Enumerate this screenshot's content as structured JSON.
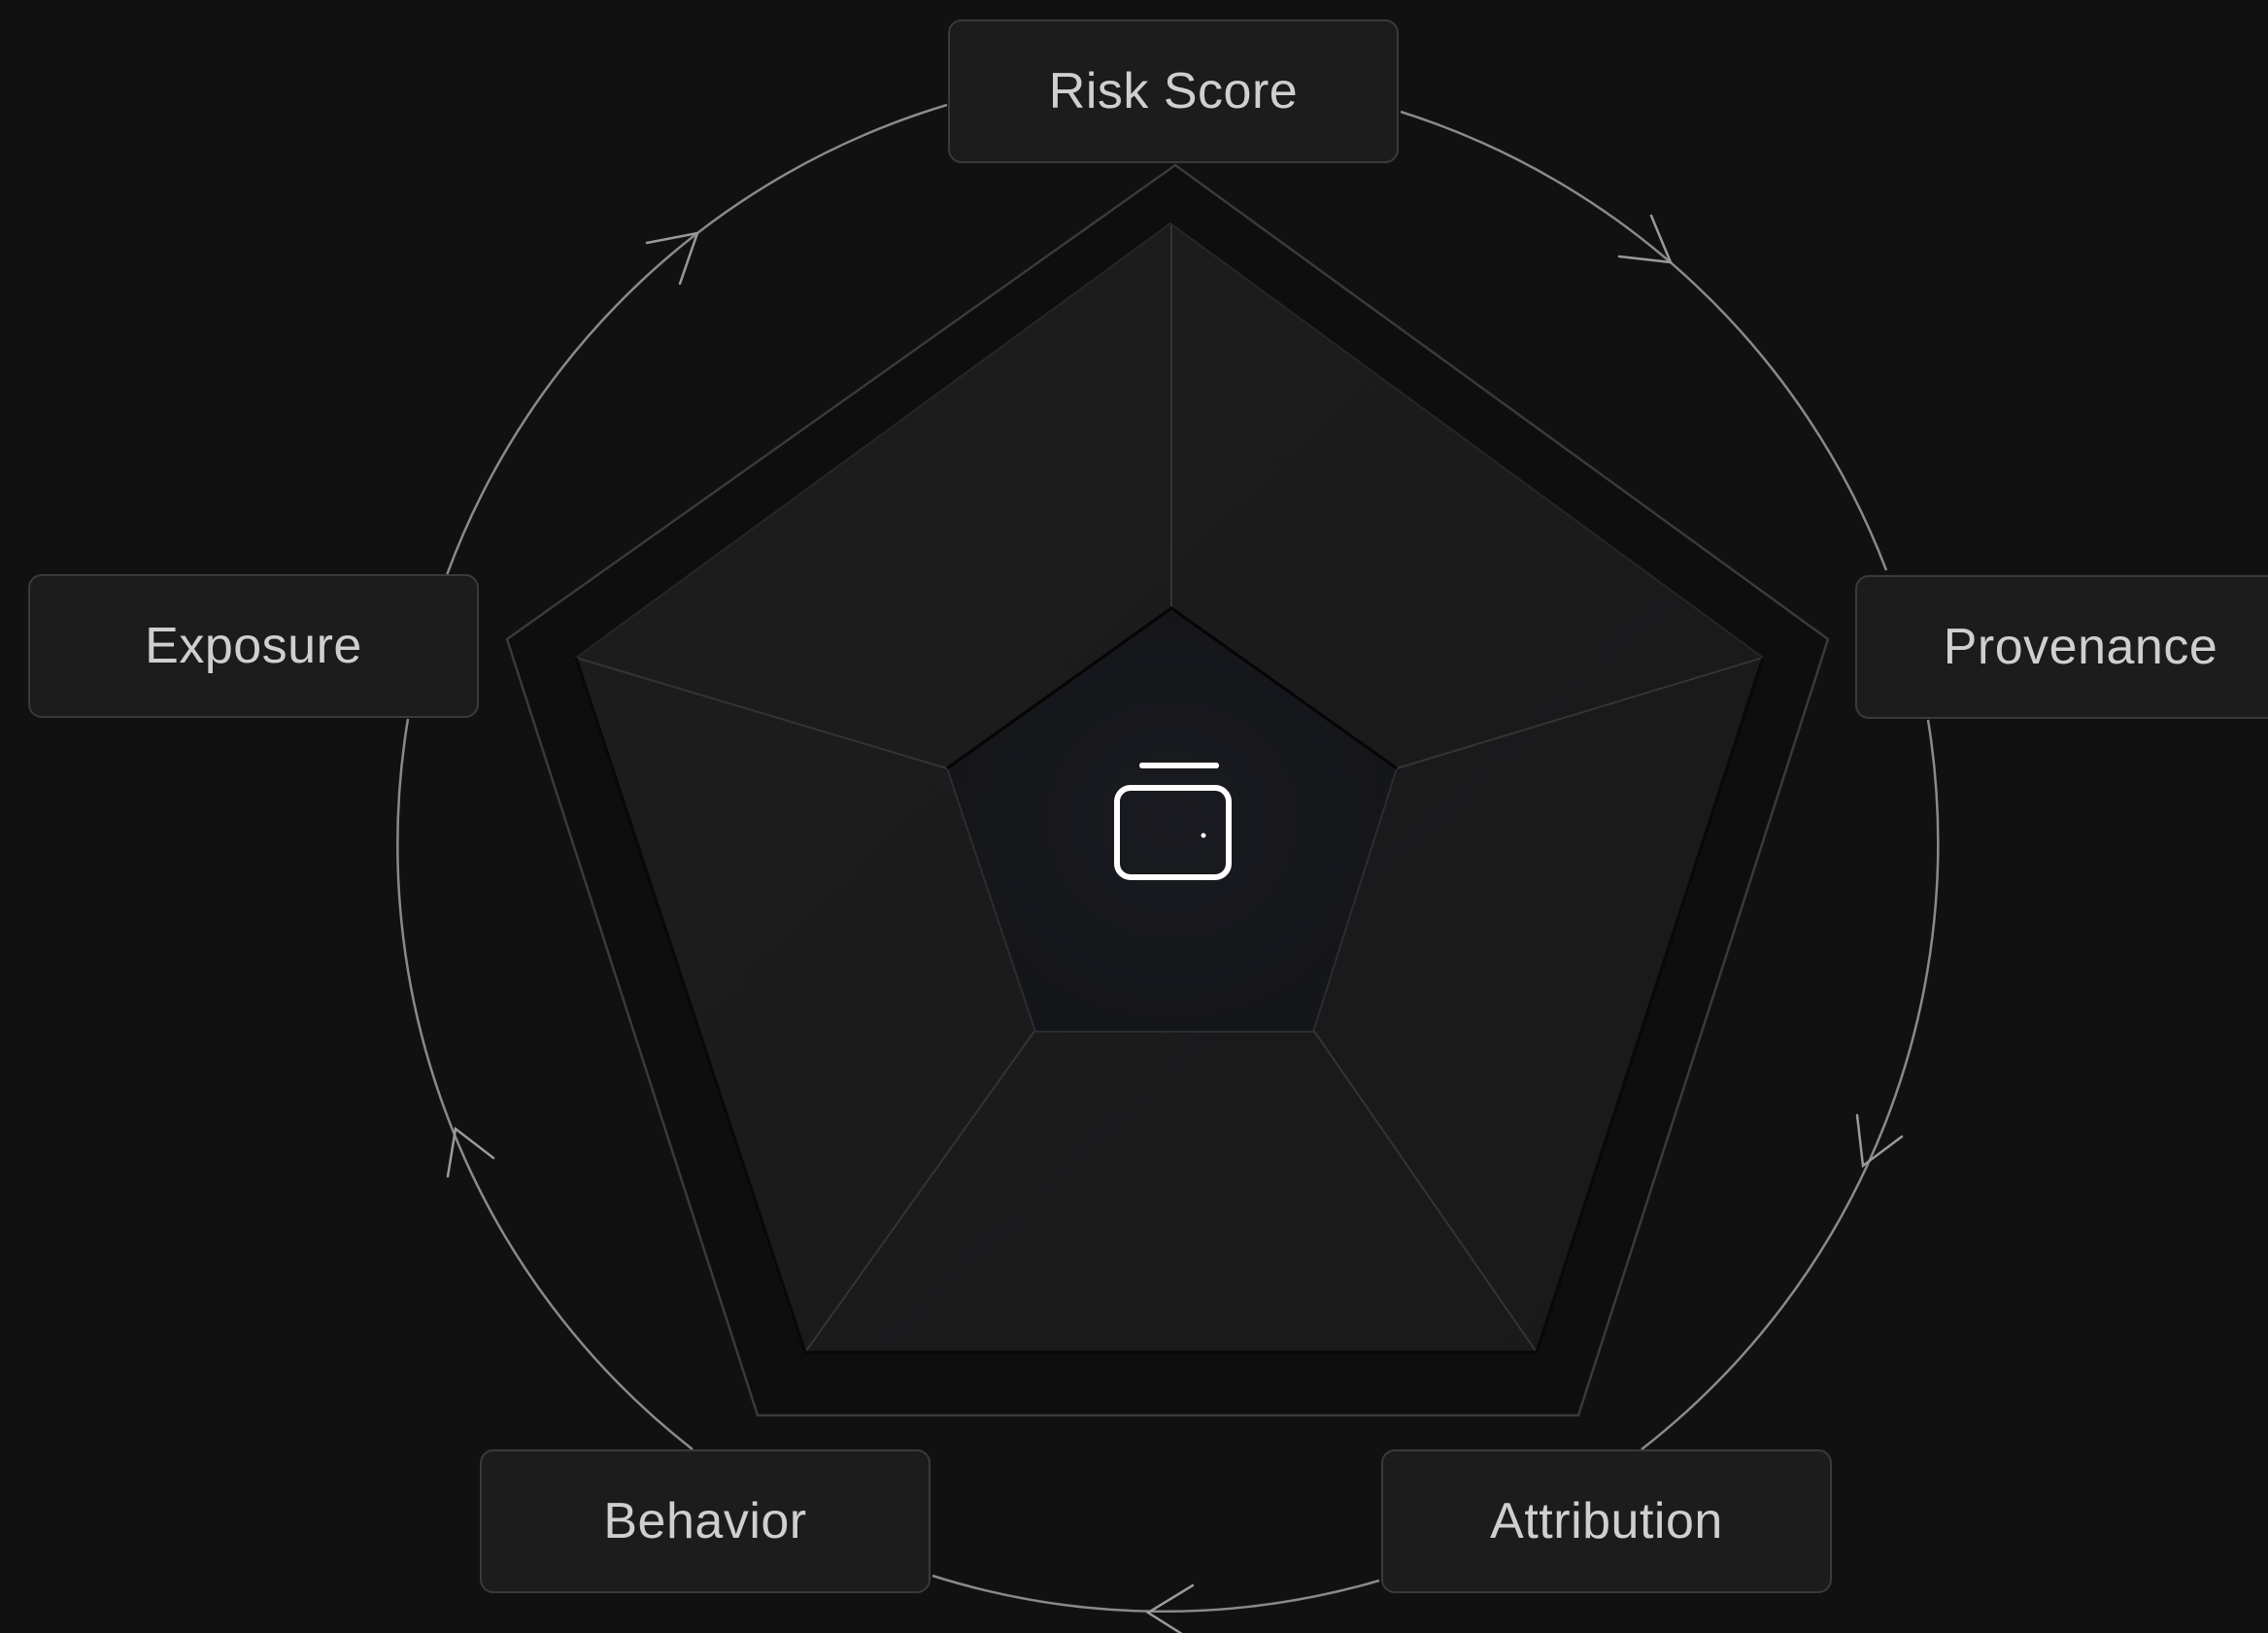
{
  "diagram": {
    "center_icon": "wallet-icon",
    "nodes": [
      {
        "id": "risk",
        "label": "Risk Score"
      },
      {
        "id": "provenance",
        "label": "Provenance"
      },
      {
        "id": "attribution",
        "label": "Attribution"
      },
      {
        "id": "behavior",
        "label": "Behavior"
      },
      {
        "id": "exposure",
        "label": "Exposure"
      }
    ],
    "flow_direction": "clockwise",
    "colors": {
      "background": "#111112",
      "node_fill": "#1c1c1d",
      "node_border": "#3a3a3c",
      "node_text": "#cfcfd1",
      "cycle_line": "#8a8a8c",
      "icon": "#ffffff"
    }
  }
}
